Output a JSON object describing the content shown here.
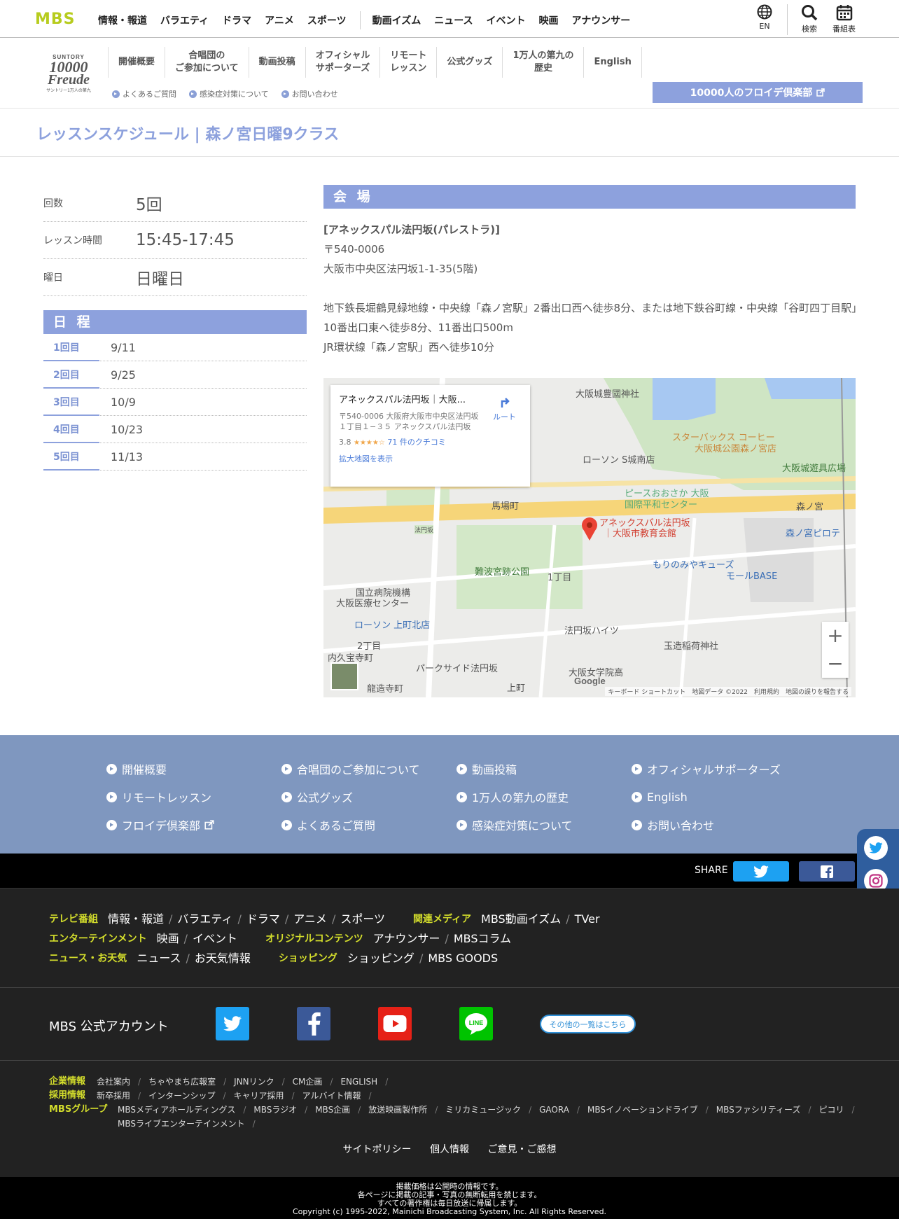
{
  "topnav": {
    "logo": "MBS",
    "items_a": [
      "情報・報道",
      "バラエティ",
      "ドラマ",
      "アニメ",
      "スポーツ"
    ],
    "items_b": [
      "動画イズム",
      "ニュース",
      "イベント",
      "映画",
      "アナウンサー"
    ],
    "lang": "EN",
    "search": "検索",
    "program": "番組表"
  },
  "brand": {
    "s": "SUNTORY",
    "n": "10000",
    "f": "Freude",
    "c": "サントリー1万人の第九"
  },
  "subnav": {
    "items": [
      "開催概要",
      "合唱団の\nご参加について",
      "動画投稿",
      "オフィシャル\nサポーターズ",
      "リモート\nレッスン",
      "公式グッズ",
      "1万人の第九の\n歴史",
      "English"
    ],
    "links": [
      "よくあるご質問",
      "感染症対策について",
      "お問い合わせ"
    ],
    "club_button": "10000人のフロイデ倶楽部"
  },
  "page": {
    "title": "レッスンスケジュール | 森ノ宮日曜9クラス"
  },
  "info": {
    "rows": [
      {
        "k": "回数",
        "v": "5回"
      },
      {
        "k": "レッスン時間",
        "v": "15:45-17:45"
      },
      {
        "k": "曜日",
        "v": "日曜日"
      }
    ]
  },
  "schedule": {
    "heading": "日 程",
    "rows": [
      {
        "k": "1回目",
        "v": "9/11"
      },
      {
        "k": "2回目",
        "v": "9/25"
      },
      {
        "k": "3回目",
        "v": "10/9"
      },
      {
        "k": "4回目",
        "v": "10/23"
      },
      {
        "k": "5回目",
        "v": "11/13"
      }
    ]
  },
  "venue": {
    "heading": "会 場",
    "name": "[アネックスパル法円坂(パレストラ)]",
    "zip": "〒540-0006",
    "address": "大阪市中央区法円坂1-1-35(5階)",
    "access1": "地下鉄長堀鶴見緑地線・中央線「森ノ宮駅」2番出口西へ徒歩8分、または地下鉄谷町線・中央線「谷町四丁目駅」10番出口東へ徒歩8分、11番出口500m",
    "access2": "JR環状線「森ノ宮駅」西へ徒歩10分"
  },
  "map": {
    "card_title": "アネックスパル法円坂｜大阪...",
    "card_address": "〒540-0006 大阪府大阪市中央区法円坂１丁目１−３５ アネックスパル法円坂",
    "rating": "3.8",
    "stars": "★★★★☆",
    "reviews": "71 件のクチコミ",
    "enlarge": "拡大地図を表示",
    "route": "ルート",
    "labels": [
      {
        "t": "大阪城豊國神社"
      },
      {
        "t": "スターバックス コーヒー"
      },
      {
        "t": "大阪城公園森ノ宮店"
      },
      {
        "t": "ローソン S城南店"
      },
      {
        "t": "大阪城遊具広場"
      },
      {
        "t": "ピースおおさか 大阪"
      },
      {
        "t": "国際平和センター"
      },
      {
        "t": "馬場町"
      },
      {
        "t": "森ノ宮"
      },
      {
        "t": "アネックスパル法円坂"
      },
      {
        "t": "｜大阪市教育会館"
      },
      {
        "t": "森ノ宮ピロテ"
      },
      {
        "t": "難波宮跡公園"
      },
      {
        "t": "もりのみやキューズ"
      },
      {
        "t": "モールBASE"
      },
      {
        "t": "国立病院機構"
      },
      {
        "t": "大阪医療センター"
      },
      {
        "t": "1丁目"
      },
      {
        "t": "ローソン 上町北店"
      },
      {
        "t": "法円坂ハイツ"
      },
      {
        "t": "玉造稲荷神社"
      },
      {
        "t": "内久宝寺町"
      },
      {
        "t": "パークサイド法円坂"
      },
      {
        "t": "龍造寺町"
      },
      {
        "t": "上町"
      },
      {
        "t": "大阪女学院高"
      },
      {
        "t": "2丁目"
      },
      {
        "t": "法円坂"
      }
    ],
    "footer": "キーボード ショートカット　地図データ ©2022　利用規約　地図の誤りを報告する",
    "google": "Google"
  },
  "footer_nav": {
    "items": [
      "開催概要",
      "合唱団のご参加について",
      "動画投稿",
      "オフィシャルサポーターズ",
      "リモートレッスン",
      "公式グッズ",
      "1万人の第九の歴史",
      "English",
      "フロイデ倶楽部",
      "よくあるご質問",
      "感染症対策について",
      "お問い合わせ"
    ]
  },
  "share": {
    "label": "SHARE"
  },
  "links": {
    "tv_cat": "テレビ番組",
    "tv": [
      "情報・報道",
      "バラエティ",
      "ドラマ",
      "アニメ",
      "スポーツ"
    ],
    "media_cat": "関連メディア",
    "media": [
      "MBS動画イズム",
      "TVer"
    ],
    "ent_cat": "エンターテインメント",
    "ent": [
      "映画",
      "イベント"
    ],
    "orig_cat": "オリジナルコンテンツ",
    "orig": [
      "アナウンサー",
      "MBSコラム"
    ],
    "news_cat": "ニュース・お天気",
    "news": [
      "ニュース",
      "お天気情報"
    ],
    "shop_cat": "ショッピング",
    "shop": [
      "ショッピング",
      "MBS GOODS"
    ]
  },
  "accounts": {
    "label": "MBS 公式アカウント",
    "others": "その他の一覧はこちら"
  },
  "corp": {
    "c1": "企業情報",
    "l1": [
      "会社案内",
      "ちゃやまち広報室",
      "JNNリンク",
      "CM企画",
      "ENGLISH"
    ],
    "c2": "採用情報",
    "l2": [
      "新卒採用",
      "インターンシップ",
      "キャリア採用",
      "アルバイト情報"
    ],
    "c3": "MBSグループ",
    "l3": [
      "MBSメディアホールディングス",
      "MBSラジオ",
      "MBS企画",
      "放送映画製作所",
      "ミリカミュージック",
      "GAORA",
      "MBSイノベーションドライブ",
      "MBSファシリティーズ",
      "ピコリ"
    ],
    "l3b": "MBSライブエンターテインメント"
  },
  "policy": [
    "サイトポリシー",
    "個人情報",
    "ご意見・ご感想"
  ],
  "copyright": [
    "掲載価格は公開時の情報です。",
    "各ページに掲載の記事・写真の無断転用を禁じます。",
    "すべての著作権は毎日放送に帰属します。",
    "Copyright (c) 1995-2022, Mainichi Broadcasting System, Inc. All Rights Reserved."
  ],
  "colors": {
    "accent": "#8da1dd",
    "mbs_green": "#b7cc1e",
    "footer_blue": "#7f97bf",
    "category_yellow": "#d4de2c"
  }
}
